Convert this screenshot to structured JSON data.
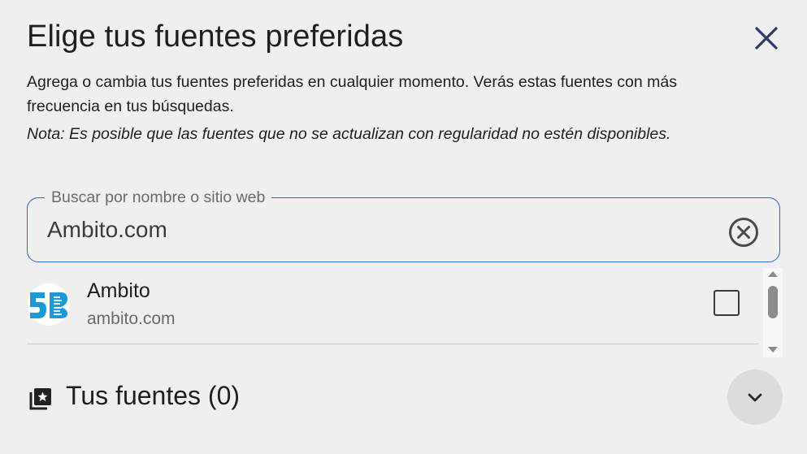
{
  "dialog": {
    "title": "Elige tus fuentes preferidas",
    "description": "Agrega o cambia tus fuentes preferidas en cualquier momento. Verás estas fuentes con más frecuencia en tus búsquedas.",
    "note": "Nota: Es posible que las fuentes que no se actualizan con regularidad no estén disponibles.",
    "close_icon": "close-icon"
  },
  "search": {
    "label": "Buscar por nombre o sitio web",
    "value": "Ambito.com",
    "clear_icon": "clear-circle-icon"
  },
  "results": [
    {
      "name": "Ambito",
      "domain": "ambito.com",
      "checked": false,
      "logo_icon": "ambito-logo"
    }
  ],
  "your_sources": {
    "label": "Tus fuentes (0)",
    "icon": "library-star-icon",
    "expand_icon": "chevron-down-icon"
  },
  "colors": {
    "accent": "#2f63c4",
    "background": "#efefef",
    "logo_blue": "#1a9ad6"
  }
}
